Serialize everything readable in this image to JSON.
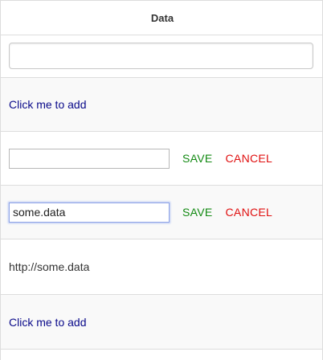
{
  "table": {
    "header": "Data",
    "filter": {
      "value": "",
      "placeholder": ""
    },
    "rows": [
      {
        "type": "link",
        "label": "Click me to add"
      },
      {
        "type": "edit",
        "value": "",
        "save_label": "SAVE",
        "cancel_label": "CANCEL"
      },
      {
        "type": "edit",
        "value": "some.data",
        "save_label": "SAVE",
        "cancel_label": "CANCEL"
      },
      {
        "type": "text",
        "label": "http://some.data"
      },
      {
        "type": "link",
        "label": "Click me to add"
      }
    ]
  },
  "colors": {
    "link": "#0a0a8a",
    "save": "#138a13",
    "cancel": "#e01010",
    "stripe": "#f9f9f9",
    "border": "#dddddd"
  }
}
